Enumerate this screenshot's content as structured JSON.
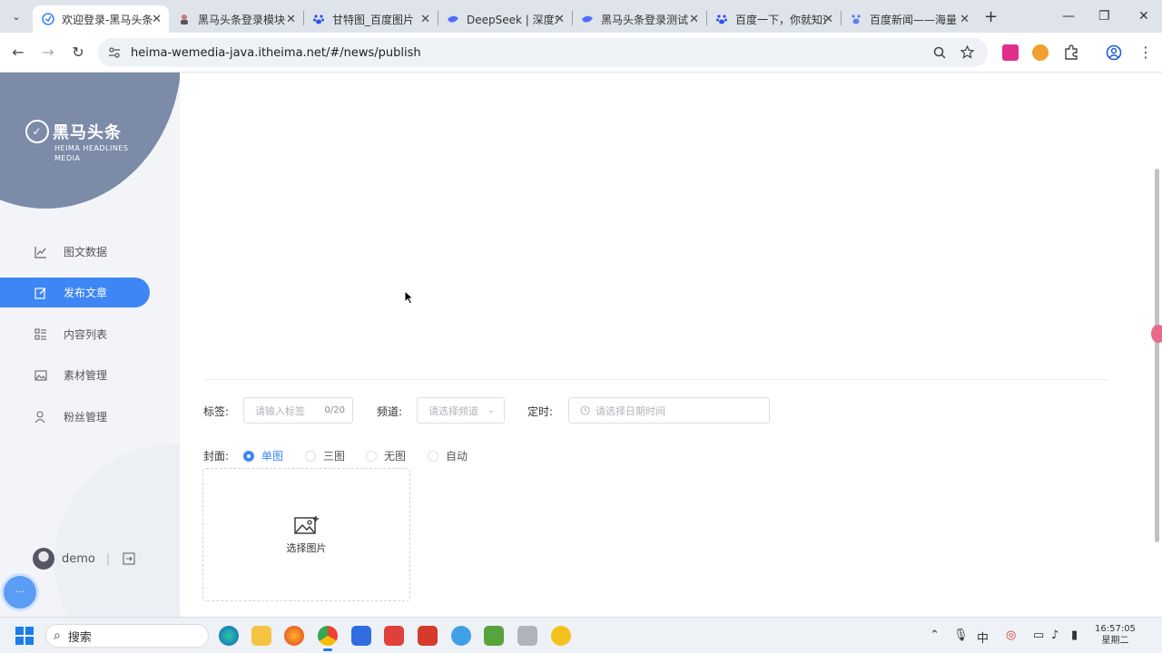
{
  "browser": {
    "tabs": [
      {
        "title": "欢迎登录-黑马头条",
        "active": true
      },
      {
        "title": "黑马头条登录模块"
      },
      {
        "title": "甘特图_百度图片"
      },
      {
        "title": "DeepSeek | 深度求索"
      },
      {
        "title": "黑马头条登录测试"
      },
      {
        "title": "百度一下，你就知道"
      },
      {
        "title": "百度新闻——海量"
      }
    ],
    "url": "heima-wemedia-java.itheima.net/#/news/publish"
  },
  "sidebar": {
    "brand": "黑马头条",
    "brand_sub_line1": "HEIMA HEADLINES",
    "brand_sub_line2": "MEDIA",
    "menu": [
      {
        "label": "图文数据",
        "icon": "chart-line-icon"
      },
      {
        "label": "发布文章",
        "icon": "edit-icon",
        "active": true
      },
      {
        "label": "内容列表",
        "icon": "list-icon"
      },
      {
        "label": "素材管理",
        "icon": "image-icon"
      },
      {
        "label": "粉丝管理",
        "icon": "user-icon"
      }
    ],
    "user": {
      "name": "demo",
      "divider": "|"
    }
  },
  "form": {
    "tag_label": "标签:",
    "tag_placeholder": "请输入标签",
    "tag_count": "0/20",
    "channel_label": "频道:",
    "channel_placeholder": "请选择频道",
    "schedule_label": "定时:",
    "schedule_placeholder": "请选择日期时间",
    "cover_label": "封面:",
    "cover_options": [
      {
        "label": "单图",
        "checked": true
      },
      {
        "label": "三图"
      },
      {
        "label": "无图"
      },
      {
        "label": "自动"
      }
    ],
    "upload_label": "选择图片"
  },
  "taskbar": {
    "search_text": "搜索",
    "time": "16:57:05",
    "weekday": "星期二"
  },
  "colors": {
    "accent": "#3e86f5",
    "sidebar_circle": "#7b8ba8"
  }
}
